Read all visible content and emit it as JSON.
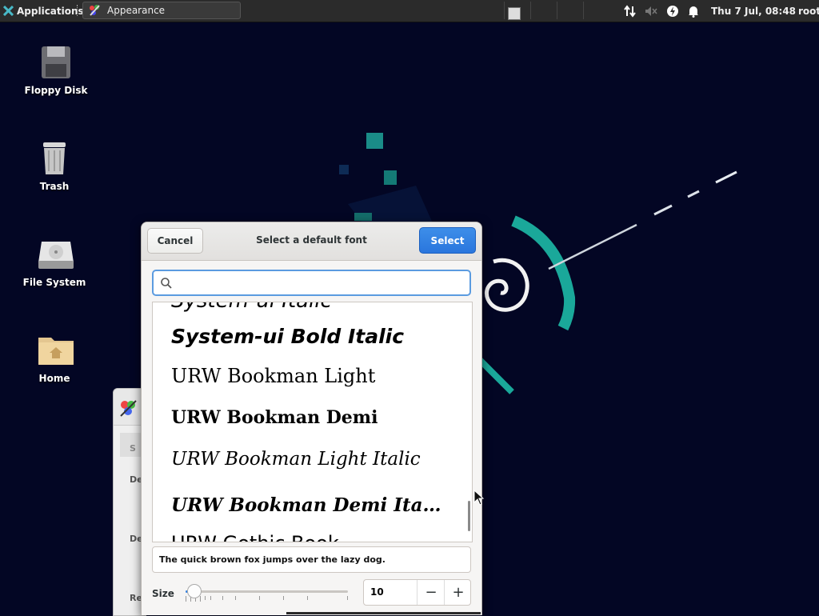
{
  "panel": {
    "applications_label": "Applications",
    "task_title": "Appearance",
    "clock": "Thu 7 Jul, 08:48",
    "user": "root",
    "tray_icons": [
      "network-transfer-icon",
      "volume-muted-icon",
      "power-icon",
      "notification-bell-icon"
    ]
  },
  "desktop": {
    "icons": [
      {
        "label": "Floppy Disk",
        "icon": "floppy-disk-icon"
      },
      {
        "label": "Trash",
        "icon": "trash-icon"
      },
      {
        "label": "File System",
        "icon": "hard-drive-icon"
      },
      {
        "label": "Home",
        "icon": "home-folder-icon"
      }
    ]
  },
  "dialog": {
    "title": "Select a default font",
    "cancel_label": "Cancel",
    "select_label": "Select",
    "search_value": "",
    "fonts": [
      "System-ui Italic",
      "System-ui Bold Italic",
      "URW Bookman Light",
      "URW Bookman Demi",
      "URW Bookman Light Italic",
      "URW Bookman Demi Ita…",
      "URW Gothic Book"
    ],
    "preview_text": "The quick brown fox jumps over the lazy dog.",
    "size_label": "Size",
    "size_value": "10",
    "minus_label": "−",
    "plus_label": "+"
  },
  "appearance_window": {
    "labels": [
      "S",
      "De",
      "De",
      "Re"
    ]
  },
  "colors": {
    "accent": "#3584e4",
    "desktop_bg": "#030624",
    "teal": "#1aa89a"
  }
}
